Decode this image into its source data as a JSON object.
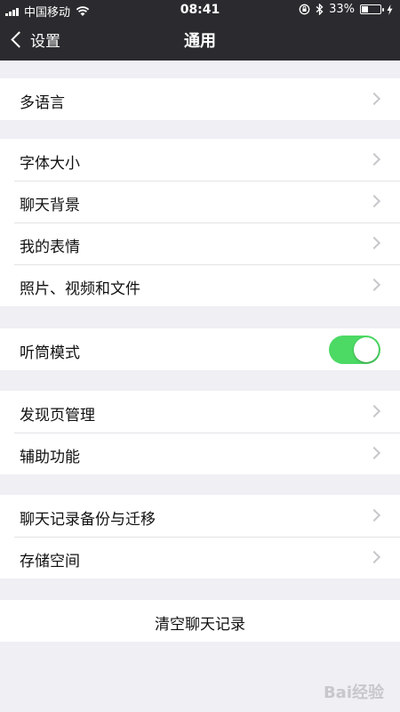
{
  "status_bar": {
    "carrier": "中国移动",
    "time": "08:41",
    "battery": "33%",
    "battery_level": 0.33,
    "icons": [
      "signal-icon",
      "wifi-icon",
      "lock-rotation-icon",
      "bluetooth-icon",
      "battery-icon",
      "charging-icon"
    ]
  },
  "nav": {
    "back_label": "设置",
    "title": "通用"
  },
  "groups": [
    {
      "rows": [
        {
          "label": "多语言"
        }
      ]
    },
    {
      "rows": [
        {
          "label": "字体大小"
        },
        {
          "label": "聊天背景"
        },
        {
          "label": "我的表情"
        },
        {
          "label": "照片、视频和文件"
        }
      ]
    },
    {
      "rows": [
        {
          "label": "听筒模式",
          "toggle": true,
          "toggle_on": true
        }
      ]
    },
    {
      "rows": [
        {
          "label": "发现页管理"
        },
        {
          "label": "辅助功能"
        }
      ]
    },
    {
      "rows": [
        {
          "label": "聊天记录备份与迁移"
        },
        {
          "label": "存储空间"
        }
      ]
    },
    {
      "rows": [
        {
          "label": "清空聊天记录"
        }
      ]
    }
  ],
  "colors": {
    "nav_bg": "#2b2b2f",
    "page_bg": "#efeff4",
    "toggle_on": "#4cd964"
  },
  "watermark": "Bai经验"
}
